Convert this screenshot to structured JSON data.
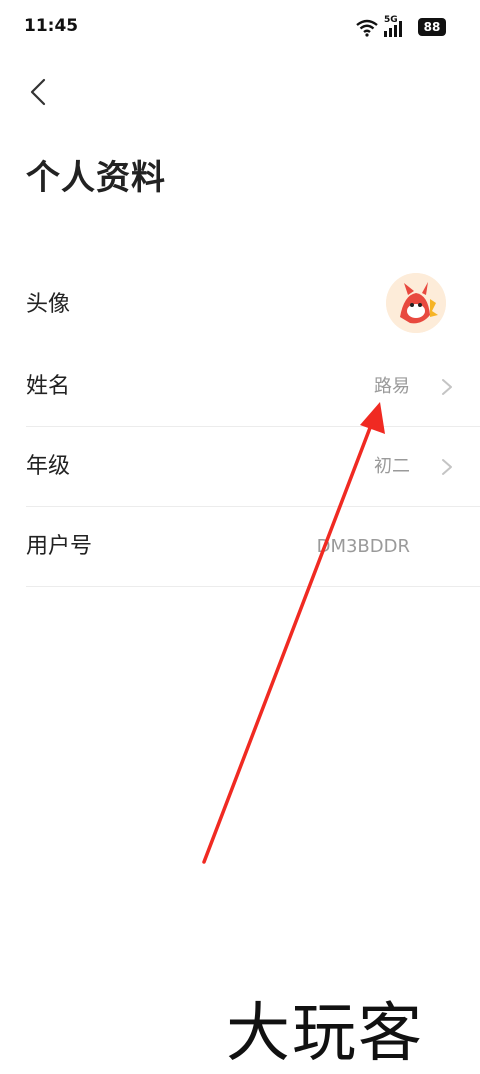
{
  "status_bar": {
    "time": "11:45",
    "network": "5G",
    "battery": "88",
    "icons": [
      "wifi-icon",
      "signal-icon",
      "battery-icon"
    ]
  },
  "header": {
    "back_icon": "chevron-left-icon",
    "title": "个人资料"
  },
  "profile": {
    "rows": [
      {
        "label": "头像",
        "value": "",
        "type": "avatar"
      },
      {
        "label": "姓名",
        "value": "路易",
        "type": "text",
        "chevron": true
      },
      {
        "label": "年级",
        "value": "初二",
        "type": "text",
        "chevron": true
      },
      {
        "label": "用户号",
        "value": "DM3BDDR",
        "type": "text",
        "chevron": false
      }
    ]
  },
  "overlay": {
    "annotation_color": "#f02a22"
  },
  "watermark": {
    "text": "大玩客"
  }
}
